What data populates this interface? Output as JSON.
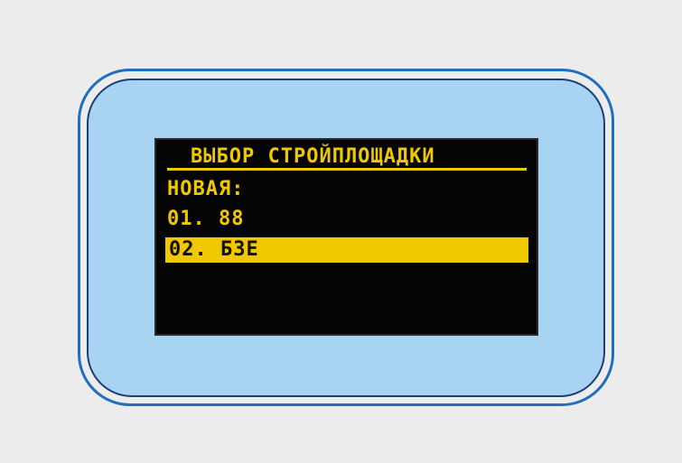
{
  "device": {
    "screen": {
      "title": "ВЫБОР СТРОЙПЛОЩАДКИ",
      "items": [
        "НОВАЯ:",
        "01. 88",
        "02. БЗЕ"
      ],
      "selected_index": 2
    },
    "colors": {
      "display_text": "#f0c800",
      "display_background": "#040404",
      "panel_fill": "#a9d3f3",
      "panel_border": "#1e6fbf"
    }
  }
}
